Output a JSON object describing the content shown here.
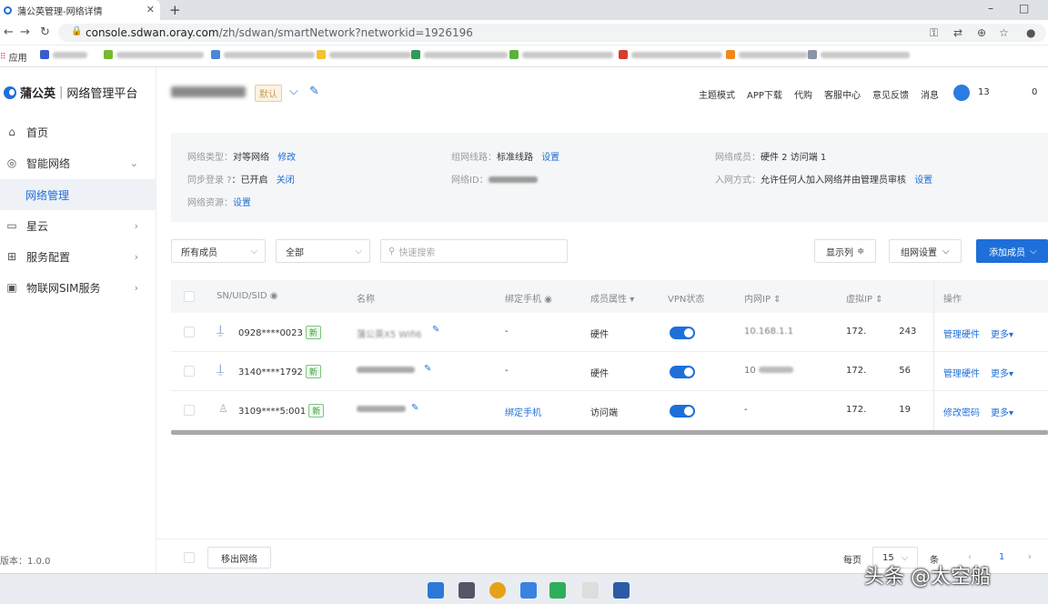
{
  "browser": {
    "tab_title": "蒲公英管理-网络详情",
    "new_tab": "+",
    "minimize": "–",
    "maximize": "□",
    "url_host": "console.sdwan.oray.com",
    "url_path": "/zh/sdwan/smartNetwork?networkid=1926196"
  },
  "bookmarks": {
    "apps": "应用"
  },
  "colors": {
    "accent": "#1e6fd9",
    "switch_on": "#1e6fd9",
    "new_badge": "#3a9a3a"
  },
  "sidebar": {
    "brand": "蒲公英",
    "platform": "网络管理平台",
    "items": [
      {
        "label": "首页",
        "icon": "home-icon"
      },
      {
        "label": "智能网络",
        "icon": "network-icon",
        "arrow": "⌄"
      },
      {
        "label": "网络管理"
      },
      {
        "label": "星云",
        "icon": "cloud-server-icon",
        "arrow": "›"
      },
      {
        "label": "服务配置",
        "icon": "grid-icon",
        "arrow": "›"
      },
      {
        "label": "物联网SIM服务",
        "icon": "sim-icon",
        "arrow": "›"
      }
    ],
    "version": "版本：1.0.0"
  },
  "header": {
    "default_tag": "默认",
    "nav": [
      "主题模式",
      "APP下载",
      "代购",
      "客服中心",
      "意见反馈",
      "消息"
    ],
    "user_prefix": "13",
    "user_suffix": "0"
  },
  "info": {
    "net_type_label": "网络类型：",
    "net_type_value": "对等网络",
    "net_type_link": "修改",
    "sync_label": "同步登录",
    "sync_value": "：已开启",
    "sync_link": "关闭",
    "resource_label": "网络资源：",
    "resource_link": "设置",
    "line_label": "组网线路：",
    "line_value": "标准线路",
    "line_link": "设置",
    "netid_label": "网络ID：",
    "members_label": "网络成员：",
    "members_value": "硬件 2    访问端 1",
    "join_label": "入网方式：",
    "join_value": "允许任何人加入网络并由管理员审核",
    "join_link": "设置"
  },
  "toolbar": {
    "member_filter": "所有成员",
    "status_filter": "全部",
    "search_placeholder": "快速搜索",
    "columns_btn": "显示列",
    "group_btn": "组网设置",
    "add_btn": "添加成员"
  },
  "table": {
    "headers": [
      "SN/UID/SID",
      "名称",
      "绑定手机",
      "成员属性",
      "VPN状态",
      "内网IP",
      "虚拟IP",
      "操作"
    ],
    "rows": [
      {
        "sn": "0928****0023",
        "badge": "新",
        "name": "蒲公英X5 Wifi6",
        "phone": "-",
        "attr": "硬件",
        "vpn_on": true,
        "lan_ip": "10.168.1.1",
        "vip_prefix": "172.",
        "vip_suffix": "243",
        "action1": "管理硬件",
        "action2": "更多"
      },
      {
        "sn": "3140****1792",
        "badge": "新",
        "name": "",
        "phone": "-",
        "attr": "硬件",
        "vpn_on": true,
        "lan_ip": "10",
        "vip_prefix": "172.",
        "vip_suffix": "56",
        "action1": "管理硬件",
        "action2": "更多"
      },
      {
        "sn": "3109****5:001",
        "badge": "新",
        "name": "",
        "phone": "绑定手机",
        "attr": "访问端",
        "vpn_on": true,
        "lan_ip": "-",
        "vip_prefix": "172.",
        "vip_suffix": "19",
        "action1": "修改密码",
        "action2": "更多"
      }
    ]
  },
  "footer": {
    "remove_btn": "移出网络",
    "per_page": "每页",
    "page_size": "15",
    "unit": "条",
    "page": "1"
  },
  "watermark": "头条 @太空船"
}
